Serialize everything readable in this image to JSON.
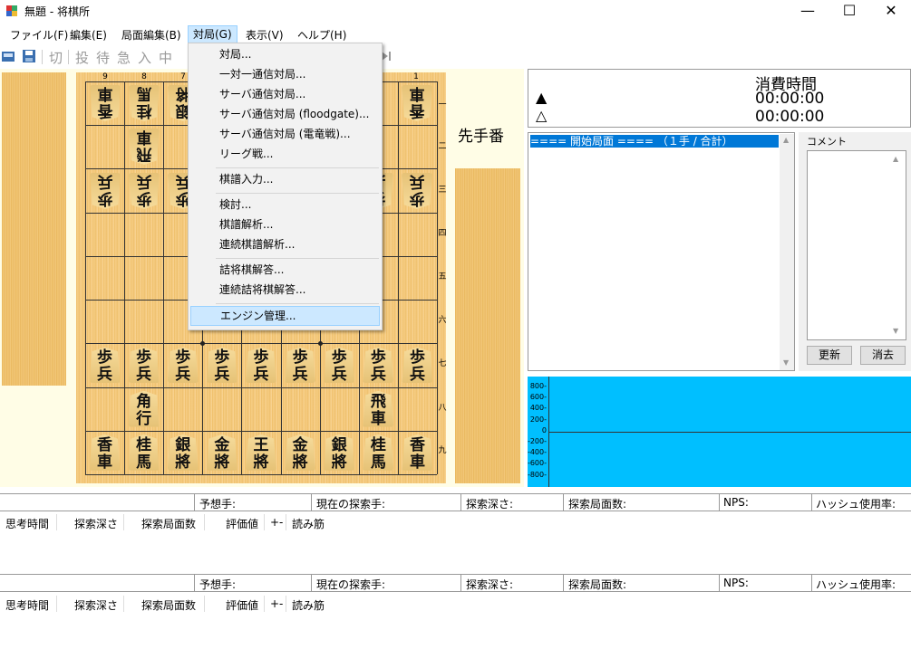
{
  "window": {
    "title": "無題 - 将棋所",
    "minimize": "—",
    "maximize": "☐",
    "close": "✕"
  },
  "menu": {
    "file": "ファイル(F)",
    "edit": "編集(E)",
    "position_edit": "局面編集(B)",
    "game": "対局(G)",
    "view": "表示(V)",
    "help": "ヘルプ(H)"
  },
  "toolbar": {
    "glyphs": [
      "切",
      "投",
      "待",
      "急",
      "入",
      "中"
    ]
  },
  "dropdown": {
    "items": [
      "対局...",
      "一対一通信対局...",
      "サーバ通信対局...",
      "サーバ通信対局 (floodgate)...",
      "サーバ通信対局 (電竜戦)...",
      "リーグ戦...",
      "棋譜入力...",
      "検討...",
      "棋譜解析...",
      "連続棋譜解析...",
      "詰将棋解答...",
      "連続詰将棋解答...",
      "エンジン管理..."
    ],
    "highlighted": "エンジン管理..."
  },
  "board": {
    "files": [
      "9",
      "8",
      "7",
      "6",
      "5",
      "4",
      "3",
      "2",
      "1"
    ],
    "ranks": [
      "一",
      "二",
      "三",
      "四",
      "五",
      "六",
      "七",
      "八",
      "九"
    ],
    "turn_label": "先手番",
    "gote_pieces": {
      "rank1": [
        "香",
        "桂",
        "銀",
        "",
        "",
        "",
        "",
        "",
        "香"
      ],
      "rank1_sub": [
        "車",
        "馬",
        "將",
        "",
        "",
        "",
        "",
        "",
        "車"
      ],
      "rank2_left": "飛",
      "rank2_left_sub": "車",
      "rank3": [
        "歩",
        "歩",
        "歩",
        "",
        "",
        "",
        "",
        "歩",
        "歩"
      ],
      "rank3_sub": [
        "兵",
        "兵",
        "兵",
        "",
        "",
        "",
        "",
        "兵",
        "兵"
      ]
    },
    "sente_pieces": {
      "rank7": [
        "歩",
        "歩",
        "歩",
        "歩",
        "歩",
        "歩",
        "歩",
        "歩",
        "歩"
      ],
      "rank7_sub": [
        "兵",
        "兵",
        "兵",
        "兵",
        "兵",
        "兵",
        "兵",
        "兵",
        "兵"
      ],
      "bishop": "角",
      "bishop_sub": "行",
      "rook": "飛",
      "rook_sub": "車",
      "rank9": [
        "香",
        "桂",
        "銀",
        "金",
        "王",
        "金",
        "銀",
        "桂",
        "香"
      ],
      "rank9_sub": [
        "車",
        "馬",
        "將",
        "將",
        "將",
        "將",
        "將",
        "馬",
        "車"
      ]
    }
  },
  "clock": {
    "title": "消費時間",
    "sente_mark": "▲",
    "gote_mark": "△",
    "sente_time": "00:00:00",
    "gote_time": "00:00:00"
  },
  "kifu": {
    "first_row": "==== 開始局面 ====  （１手 / 合計）"
  },
  "comment": {
    "label": "コメント",
    "update_button": "更新",
    "clear_button": "消去"
  },
  "graph": {
    "y_labels": [
      "800-",
      "600-",
      "400-",
      "200-",
      "0",
      "-200-",
      "-400-",
      "-600-",
      "-800-"
    ]
  },
  "engine1": {
    "predicted": "予想手:",
    "current_move": "現在の探索手:",
    "depth": "探索深さ:",
    "nodes": "探索局面数:",
    "nps": "NPS:",
    "hash": "ハッシュ使用率:",
    "headers": [
      "思考時間",
      "探索深さ",
      "探索局面数",
      "評価値",
      "+-",
      "読み筋"
    ]
  },
  "engine2": {
    "predicted": "予想手:",
    "current_move": "現在の探索手:",
    "depth": "探索深さ:",
    "nodes": "探索局面数:",
    "nps": "NPS:",
    "hash": "ハッシュ使用率:",
    "headers": [
      "思考時間",
      "探索深さ",
      "探索局面数",
      "評価値",
      "+-",
      "読み筋"
    ]
  }
}
